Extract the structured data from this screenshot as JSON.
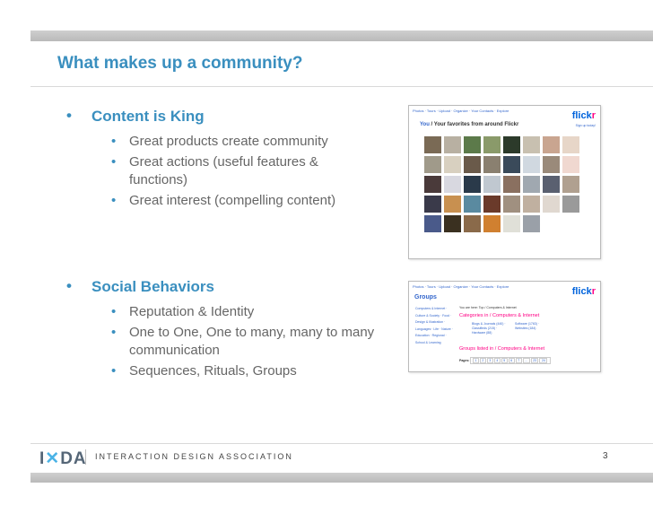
{
  "slide": {
    "title": "What makes up a community?",
    "page_number": "3",
    "footer_org": "INTERACTION DESIGN ASSOCIATION",
    "logo": "IxDA",
    "sections": [
      {
        "heading": "Content is King",
        "items": [
          "Great products create community",
          "Great actions (useful features & functions)",
          "Great interest (compelling content)"
        ]
      },
      {
        "heading": "Social Behaviors",
        "items": [
          "Reputation & Identity",
          "One to One, One to many, many to many communication",
          "Sequences, Rituals, Groups"
        ]
      }
    ]
  },
  "screenshot1": {
    "nav": "Photos · Tours · Upload · Organize · Your Contacts · Explore",
    "logo_flickr": "flick",
    "logo_r": "r",
    "heading_you": "You",
    "heading_rest": " / Your favorites from around Flickr",
    "side_text": "Sign up today!",
    "thumb_colors": [
      "#7a6a55",
      "#b8b0a2",
      "#5c7a4a",
      "#8a9a6a",
      "#2c3a2a",
      "#c8c0b0",
      "#c9a590",
      "#e7d6c8",
      "#a09a8a",
      "#d8d0c0",
      "#6a5a4a",
      "#8a8070",
      "#3a4a5a",
      "#d0d8e0",
      "#9a8a7a",
      "#f0d8d0",
      "#4a3a3a",
      "#d8d8e0",
      "#2a3a4a",
      "#c0c8d0",
      "#8a7060",
      "#a0a8b0",
      "#5a6070",
      "#b0a090",
      "#3a3a4a",
      "#c89050",
      "#5a8aa0",
      "#6a3a2a",
      "#a09080",
      "#c0b0a0",
      "#e0d8d0",
      "#9a9a9a",
      "#4a5a8a",
      "#3a3020",
      "#8a6a4a",
      "#d08030",
      "#e0e0d8",
      "#9aa0a8"
    ]
  },
  "screenshot2": {
    "nav": "Photos · Tours · Upload · Organize · Your Contacts · Explore",
    "logo_flickr": "flick",
    "logo_r": "r",
    "groups_title": "Groups",
    "left_links": "Computers & Internet · Culture & Society · Food · Design & Illustration · Languages · Life · Nature · Education · Regional · School & Learning",
    "crumb": "You are here: Top / Computers & Internet",
    "category": "Categories in / Computers & Internet",
    "sub_col1": "Blogs & Journals (440) · Classifieds (215) · Hardware (88)",
    "sub_col2": "Software (1763) · Websites (184)",
    "listed": "Groups listed in / Computers & Internet",
    "pages_label": "Pages:",
    "pages": [
      "1",
      "2",
      "3",
      "4",
      "5",
      "6",
      "7",
      "...",
      "23",
      "24"
    ]
  }
}
